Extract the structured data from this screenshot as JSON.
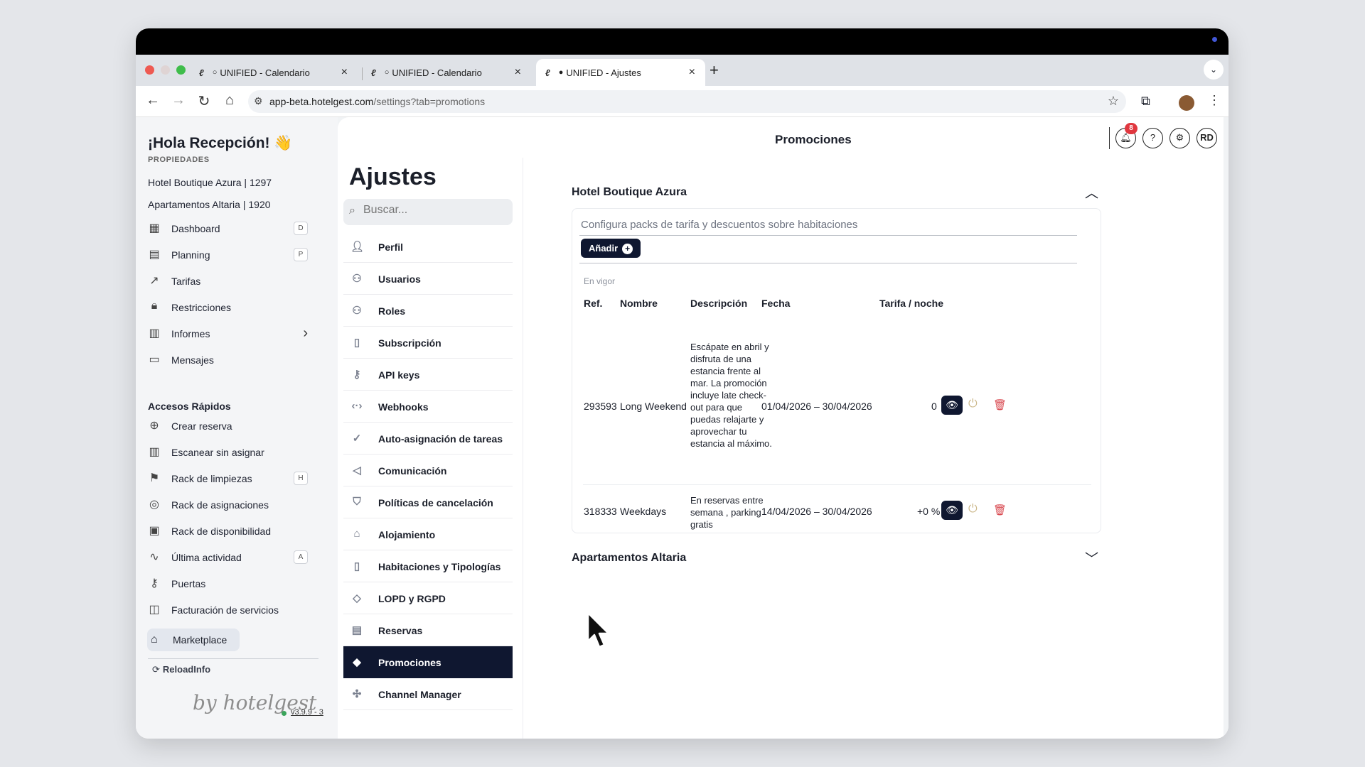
{
  "browser": {
    "tabs": [
      {
        "title": "UNIFIED - Calendario",
        "favicon": "hotelgest-favicon",
        "status": "○"
      },
      {
        "title": "UNIFIED - Calendario",
        "favicon": "hotelgest-favicon",
        "status": "○"
      },
      {
        "title": "UNIFIED - Ajustes",
        "favicon": "hotelgest-favicon",
        "status": "●"
      }
    ],
    "url_host": "app-beta.hotelgest.com",
    "url_path": "/settings?tab=promotions"
  },
  "sidebar": {
    "greeting": "¡Hola Recepción! 👋",
    "properties_label": "PROPIEDADES",
    "properties": [
      "Hotel Boutique Azura | 1297",
      "Apartamentos Altaria | 1920"
    ],
    "nav": [
      {
        "label": "Dashboard",
        "icon": "dashboard-icon",
        "key": "D"
      },
      {
        "label": "Planning",
        "icon": "calendar-icon",
        "key": "P"
      },
      {
        "label": "Tarifas",
        "icon": "trend-icon"
      },
      {
        "label": "Restricciones",
        "icon": "lock-icon"
      },
      {
        "label": "Informes",
        "icon": "report-icon",
        "chevron": "›"
      },
      {
        "label": "Mensajes",
        "icon": "message-icon"
      }
    ],
    "quick_title": "Accesos Rápidos",
    "quick": [
      {
        "label": "Crear reserva",
        "icon": "plus-circle-icon"
      },
      {
        "label": "Escanear sin asignar",
        "icon": "barcode-icon"
      },
      {
        "label": "Rack de limpiezas",
        "icon": "broom-icon",
        "key": "H"
      },
      {
        "label": "Rack de asignaciones",
        "icon": "target-icon"
      },
      {
        "label": "Rack de disponibilidad",
        "icon": "calendar-check-icon"
      },
      {
        "label": "Última actividad",
        "icon": "activity-icon",
        "key": "A"
      },
      {
        "label": "Puertas",
        "icon": "key-icon"
      },
      {
        "label": "Facturación de servicios",
        "icon": "bag-icon"
      }
    ],
    "marketplace": "Marketplace",
    "reload": "ReloadInfo",
    "signature": "by hotelgest",
    "version": "v3.9.9 - 3"
  },
  "settings": {
    "title": "Ajustes",
    "search_placeholder": "Buscar...",
    "menu": [
      {
        "label": "Perfil",
        "icon": "user-icon"
      },
      {
        "label": "Usuarios",
        "icon": "users-icon"
      },
      {
        "label": "Roles",
        "icon": "roles-icon"
      },
      {
        "label": "Subscripción",
        "icon": "document-icon"
      },
      {
        "label": "API keys",
        "icon": "key-icon"
      },
      {
        "label": "Webhooks",
        "icon": "webhook-icon"
      },
      {
        "label": "Auto-asignación de tareas",
        "icon": "check-circle-icon"
      },
      {
        "label": "Comunicación",
        "icon": "megaphone-icon"
      },
      {
        "label": "Políticas de cancelación",
        "icon": "shield-icon"
      },
      {
        "label": "Alojamiento",
        "icon": "home-icon"
      },
      {
        "label": "Habitaciones y Tipologías",
        "icon": "document-icon"
      },
      {
        "label": "LOPD y RGPD",
        "icon": "graduation-icon"
      },
      {
        "label": "Reservas",
        "icon": "calendar-icon"
      },
      {
        "label": "Promociones",
        "icon": "tag-icon",
        "active": true
      },
      {
        "label": "Channel Manager",
        "icon": "puzzle-icon"
      }
    ]
  },
  "header": {
    "title": "Promociones",
    "notifications": "8",
    "help": "?",
    "settings": "⚙",
    "avatar": "RD"
  },
  "promotions": {
    "section_title": "Hotel Boutique Azura",
    "description": "Configura packs de tarifa y descuentos sobre habitaciones",
    "add_label": "Añadir",
    "status": "En vigor",
    "columns": {
      "ref": "Ref.",
      "name": "Nombre",
      "description": "Descripción",
      "date": "Fecha",
      "rate": "Tarifa / noche"
    },
    "rows": [
      {
        "ref": "293593",
        "name": "Long Weekend",
        "description": "Escápate en abril y disfruta de una estancia frente al mar. La promoción incluye late check-out para que puedas relajarte y aprovechar tu estancia al máximo.",
        "date": "01/04/2026 – 30/04/2026",
        "rate": "0"
      },
      {
        "ref": "318333",
        "name": "Weekdays",
        "description": "En reservas entre semana , parking gratis",
        "date": "14/04/2026 – 30/04/2026",
        "rate": "+0 %"
      }
    ],
    "collapsed_title": "Apartamentos Altaria"
  },
  "colors": {
    "accent": "#0f1730",
    "danger": "#d8474e",
    "badge": "#e0373f"
  }
}
